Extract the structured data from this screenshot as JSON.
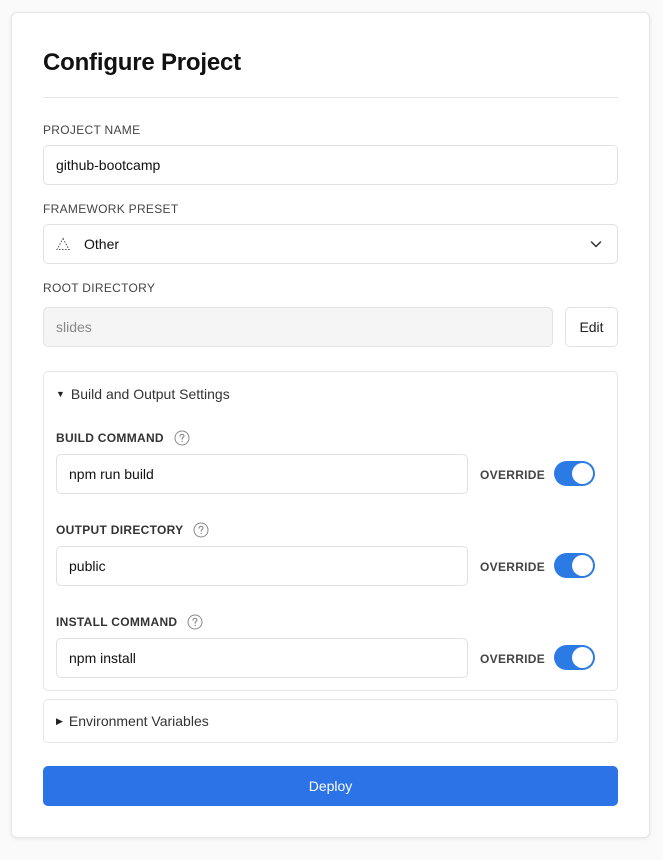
{
  "title": "Configure Project",
  "project_name": {
    "label": "PROJECT NAME",
    "value": "github-bootcamp"
  },
  "framework_preset": {
    "label": "FRAMEWORK PRESET",
    "value": "Other",
    "icon": "triangle-icon"
  },
  "root_directory": {
    "label": "ROOT DIRECTORY",
    "value": "slides",
    "edit_label": "Edit"
  },
  "build_settings": {
    "header": "Build and Output Settings",
    "rows": [
      {
        "label": "BUILD COMMAND",
        "value": "npm run build",
        "override_label": "OVERRIDE",
        "override": true
      },
      {
        "label": "OUTPUT DIRECTORY",
        "value": "public",
        "override_label": "OVERRIDE",
        "override": true
      },
      {
        "label": "INSTALL COMMAND",
        "value": "npm install",
        "override_label": "OVERRIDE",
        "override": true
      }
    ]
  },
  "env_vars": {
    "header": "Environment Variables"
  },
  "deploy_label": "Deploy",
  "colors": {
    "accent": "#2b73e6",
    "toggle_on": "#2c7be5"
  }
}
